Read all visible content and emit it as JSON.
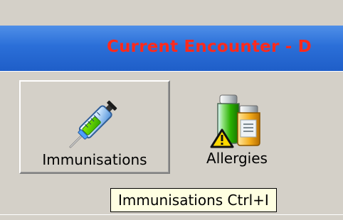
{
  "window": {
    "title": "Current Encounter - D"
  },
  "toolbar": {
    "immunisations_label": "Immunisations",
    "allergies_label": "Allergies"
  },
  "tooltip": {
    "text": "Immunisations  Ctrl+I"
  },
  "icons": {
    "immunisations": "syringe-icon",
    "allergies": "medicine-bottles-warning-icon"
  },
  "colors": {
    "title_text": "#ff2a1c",
    "titlebar_blue": "#2b6fd8",
    "tooltip_background": "#ffffe1",
    "window_background": "#d4d0c8"
  }
}
